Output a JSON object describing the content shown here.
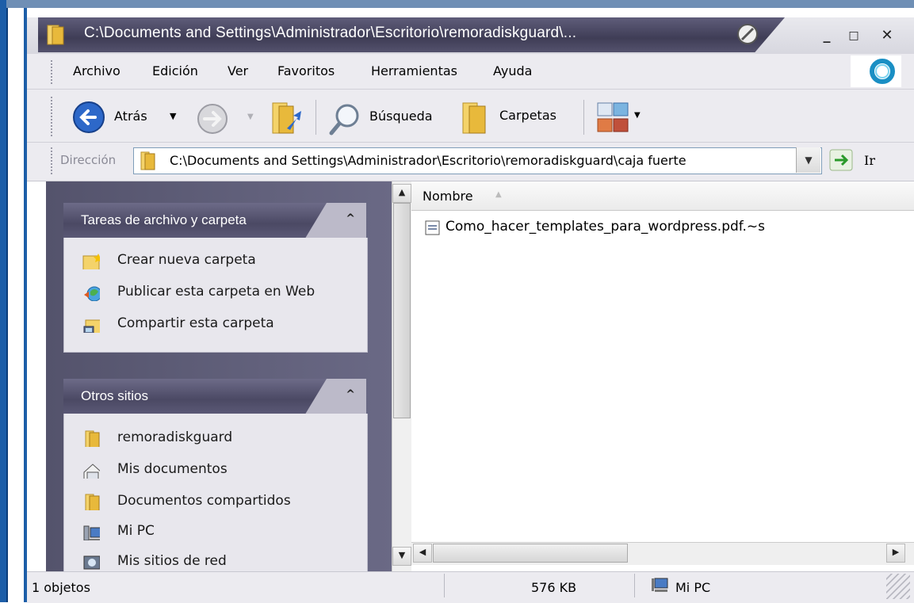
{
  "window": {
    "title": "C:\\Documents and Settings\\Administrador\\Escritorio\\remoradiskguard\\..."
  },
  "menu": [
    "Archivo",
    "Edición",
    "Ver",
    "Favoritos",
    "Herramientas",
    "Ayuda"
  ],
  "toolbar": {
    "back_label": "Atrás",
    "search_label": "Búsqueda",
    "folders_label": "Carpetas"
  },
  "address": {
    "label": "Dirección",
    "value": "C:\\Documents and Settings\\Administrador\\Escritorio\\remoradiskguard\\caja fuerte",
    "go_label": "Ir"
  },
  "tasks_panel": {
    "title": "Tareas de archivo y carpeta",
    "items": [
      "Crear nueva carpeta",
      "Publicar esta carpeta en Web",
      "Compartir esta carpeta"
    ]
  },
  "places_panel": {
    "title": "Otros sitios",
    "items": [
      "remoradiskguard",
      "Mis documentos",
      "Documentos compartidos",
      "Mi PC",
      "Mis sitios de red"
    ]
  },
  "files": {
    "column_name": "Nombre",
    "items": [
      "Como_hacer_templates_para_wordpress.pdf.~s"
    ]
  },
  "statusbar": {
    "count": "1 objetos",
    "size": "576 KB",
    "location": "Mi PC"
  },
  "colors": {
    "title_bar": "#4b4964",
    "sidebar": "#5f5e79",
    "frame_blue": "#1d5ea8"
  }
}
